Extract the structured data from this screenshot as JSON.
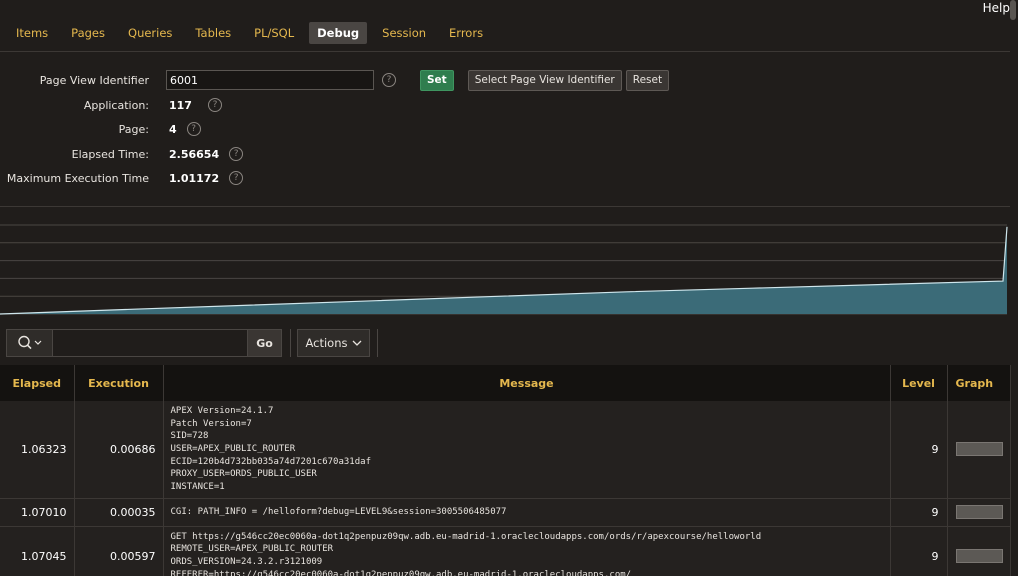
{
  "help": "Help",
  "tabs": [
    "Items",
    "Pages",
    "Queries",
    "Tables",
    "PL/SQL",
    "Debug",
    "Session",
    "Errors"
  ],
  "active_tab": "Debug",
  "form": {
    "pvid_label": "Page View Identifier",
    "pvid_value": "6001",
    "set_label": "Set",
    "select_label": "Select Page View Identifier",
    "reset_label": "Reset",
    "application_label": "Application:",
    "application_value": "117",
    "page_label": "Page:",
    "page_value": "4",
    "elapsed_label": "Elapsed Time:",
    "elapsed_value": "2.56654",
    "maxexec_label": "Maximum Execution Time",
    "maxexec_value": "1.01172",
    "help_glyph": "?"
  },
  "toolbar": {
    "go_label": "Go",
    "actions_label": "Actions"
  },
  "colors": {
    "accent": "#e5b84e",
    "area_fill": "#3b6b78",
    "area_line": "#cfe6ec",
    "set_button": "#2f7d4e"
  },
  "columns": [
    "Elapsed",
    "Execution",
    "Message",
    "Level",
    "Graph"
  ],
  "rows": [
    {
      "elapsed": "1.06323",
      "execution": "0.00686",
      "message": "APEX Version=24.1.7\nPatch Version=7\nSID=728\nUSER=APEX_PUBLIC_ROUTER\nECID=120b4d732bb035a74d7201c670a31daf\nPROXY_USER=ORDS_PUBLIC_USER\nINSTANCE=1",
      "level": "9"
    },
    {
      "elapsed": "1.07010",
      "execution": "0.00035",
      "message": "CGI: PATH_INFO = /helloform?debug=LEVEL9&session=3005506485077",
      "level": "9"
    },
    {
      "elapsed": "1.07045",
      "execution": "0.00597",
      "message": "GET https://g546cc20ec0060a-dot1q2penpuz09qw.adb.eu-madrid-1.oraclecloudapps.com/ords/r/apexcourse/helloworld\nREMOTE_USER=APEX_PUBLIC_ROUTER\nORDS_VERSION=24.3.2.r3121009\nREFERER=https://g546cc20ec0060a-dot1q2penpuz09qw.adb.eu-madrid-1.oraclecloudapps.com/",
      "level": "9"
    }
  ],
  "chart_data": {
    "type": "area",
    "x_range": [
      0,
      1
    ],
    "y_range": [
      0,
      1
    ],
    "series": [
      {
        "values": [
          0.0,
          0.05,
          0.1,
          0.15,
          0.2,
          0.25,
          0.29,
          0.33,
          0.37,
          0.98
        ]
      }
    ]
  }
}
